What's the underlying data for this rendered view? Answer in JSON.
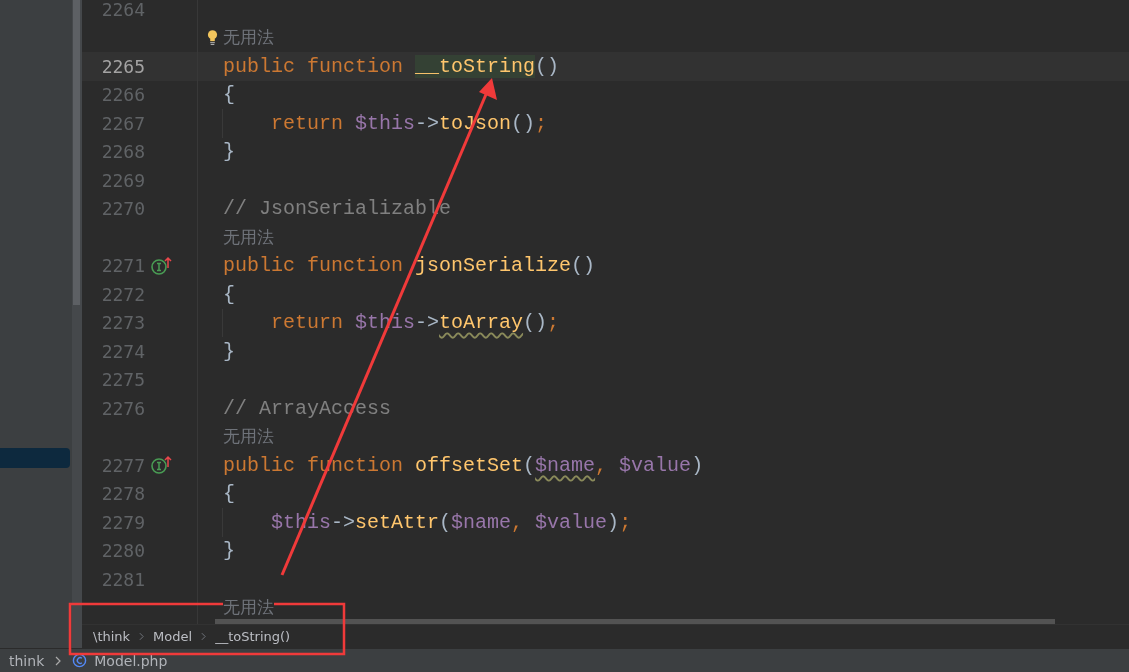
{
  "editor": {
    "rows": [
      {
        "kind": "code",
        "number": "2264",
        "current": false,
        "indented": false,
        "implements": false
      },
      {
        "kind": "hint",
        "text": "无用法",
        "bulb": true
      },
      {
        "kind": "code",
        "number": "2265",
        "current": true,
        "indented": false,
        "implements": false,
        "tokens": [
          {
            "kind": "keyword",
            "text": "public"
          },
          {
            "kind": "keyword",
            "text": "function"
          },
          {
            "kind": "fn-highlighted",
            "text": "__toString"
          },
          {
            "kind": "punct",
            "text": "()"
          }
        ]
      },
      {
        "kind": "code",
        "number": "2266",
        "current": false,
        "indented": false,
        "implements": false,
        "tokens": [
          {
            "kind": "punct",
            "text": "{"
          }
        ]
      },
      {
        "kind": "code",
        "number": "2267",
        "current": false,
        "indented": true,
        "implements": false,
        "tokens": [
          {
            "kind": "keyword",
            "text": "return"
          },
          {
            "kind": "var",
            "text": "$this"
          },
          {
            "kind": "punct",
            "text": "->"
          },
          {
            "kind": "fn",
            "text": "toJson"
          },
          {
            "kind": "punct",
            "text": "()"
          },
          {
            "kind": "semicolon",
            "text": ";"
          }
        ]
      },
      {
        "kind": "code",
        "number": "2268",
        "current": false,
        "indented": false,
        "implements": false,
        "tokens": [
          {
            "kind": "punct",
            "text": "}"
          }
        ]
      },
      {
        "kind": "code",
        "number": "2269",
        "current": false,
        "indented": false,
        "implements": false
      },
      {
        "kind": "code",
        "number": "2270",
        "current": false,
        "indented": false,
        "implements": false,
        "tokens": [
          {
            "kind": "comment",
            "text": "// JsonSerializable"
          }
        ]
      },
      {
        "kind": "hint",
        "text": "无用法",
        "bulb": false
      },
      {
        "kind": "code",
        "number": "2271",
        "current": false,
        "indented": false,
        "implements": true,
        "tokens": [
          {
            "kind": "keyword",
            "text": "public"
          },
          {
            "kind": "keyword",
            "text": "function"
          },
          {
            "kind": "fn",
            "text": "jsonSerialize"
          },
          {
            "kind": "punct",
            "text": "()"
          }
        ]
      },
      {
        "kind": "code",
        "number": "2272",
        "current": false,
        "indented": false,
        "implements": false,
        "tokens": [
          {
            "kind": "punct",
            "text": "{"
          }
        ]
      },
      {
        "kind": "code",
        "number": "2273",
        "current": false,
        "indented": true,
        "implements": false,
        "tokens": [
          {
            "kind": "keyword",
            "text": "return"
          },
          {
            "kind": "var",
            "text": "$this"
          },
          {
            "kind": "punct",
            "text": "->"
          },
          {
            "kind": "fn-squiggle",
            "text": "toArray"
          },
          {
            "kind": "punct",
            "text": "()"
          },
          {
            "kind": "semicolon",
            "text": ";"
          }
        ]
      },
      {
        "kind": "code",
        "number": "2274",
        "current": false,
        "indented": false,
        "implements": false,
        "tokens": [
          {
            "kind": "punct",
            "text": "}"
          }
        ]
      },
      {
        "kind": "code",
        "number": "2275",
        "current": false,
        "indented": false,
        "implements": false
      },
      {
        "kind": "code",
        "number": "2276",
        "current": false,
        "indented": false,
        "implements": false,
        "tokens": [
          {
            "kind": "comment",
            "text": "// ArrayAccess"
          }
        ]
      },
      {
        "kind": "hint",
        "text": "无用法",
        "bulb": false
      },
      {
        "kind": "code",
        "number": "2277",
        "current": false,
        "indented": false,
        "implements": true,
        "tokens": [
          {
            "kind": "keyword",
            "text": "public"
          },
          {
            "kind": "keyword",
            "text": "function"
          },
          {
            "kind": "fn",
            "text": "offsetSet"
          },
          {
            "kind": "punct",
            "text": "("
          },
          {
            "kind": "var-squiggle",
            "text": "$name"
          },
          {
            "kind": "comma",
            "text": ","
          },
          {
            "kind": "var",
            "text": "$value"
          },
          {
            "kind": "punct",
            "text": ")"
          }
        ]
      },
      {
        "kind": "code",
        "number": "2278",
        "current": false,
        "indented": false,
        "implements": false,
        "tokens": [
          {
            "kind": "punct",
            "text": "{"
          }
        ]
      },
      {
        "kind": "code",
        "number": "2279",
        "current": false,
        "indented": true,
        "implements": false,
        "tokens": [
          {
            "kind": "var",
            "text": "$this"
          },
          {
            "kind": "punct",
            "text": "->"
          },
          {
            "kind": "fn",
            "text": "setAttr"
          },
          {
            "kind": "punct",
            "text": "("
          },
          {
            "kind": "var",
            "text": "$name"
          },
          {
            "kind": "comma",
            "text": ","
          },
          {
            "kind": "var",
            "text": "$value"
          },
          {
            "kind": "punct",
            "text": ")"
          },
          {
            "kind": "semicolon",
            "text": ";"
          }
        ]
      },
      {
        "kind": "code",
        "number": "2280",
        "current": false,
        "indented": false,
        "implements": false,
        "tokens": [
          {
            "kind": "punct",
            "text": "}"
          }
        ]
      },
      {
        "kind": "code",
        "number": "2281",
        "current": false,
        "indented": false,
        "implements": false
      },
      {
        "kind": "hint",
        "text": "无用法",
        "bulb": false
      }
    ]
  },
  "breadcrumbs": [
    "\\think",
    "Model",
    "__toString()"
  ],
  "status_bar": {
    "project": "think",
    "file": "Model.php"
  }
}
